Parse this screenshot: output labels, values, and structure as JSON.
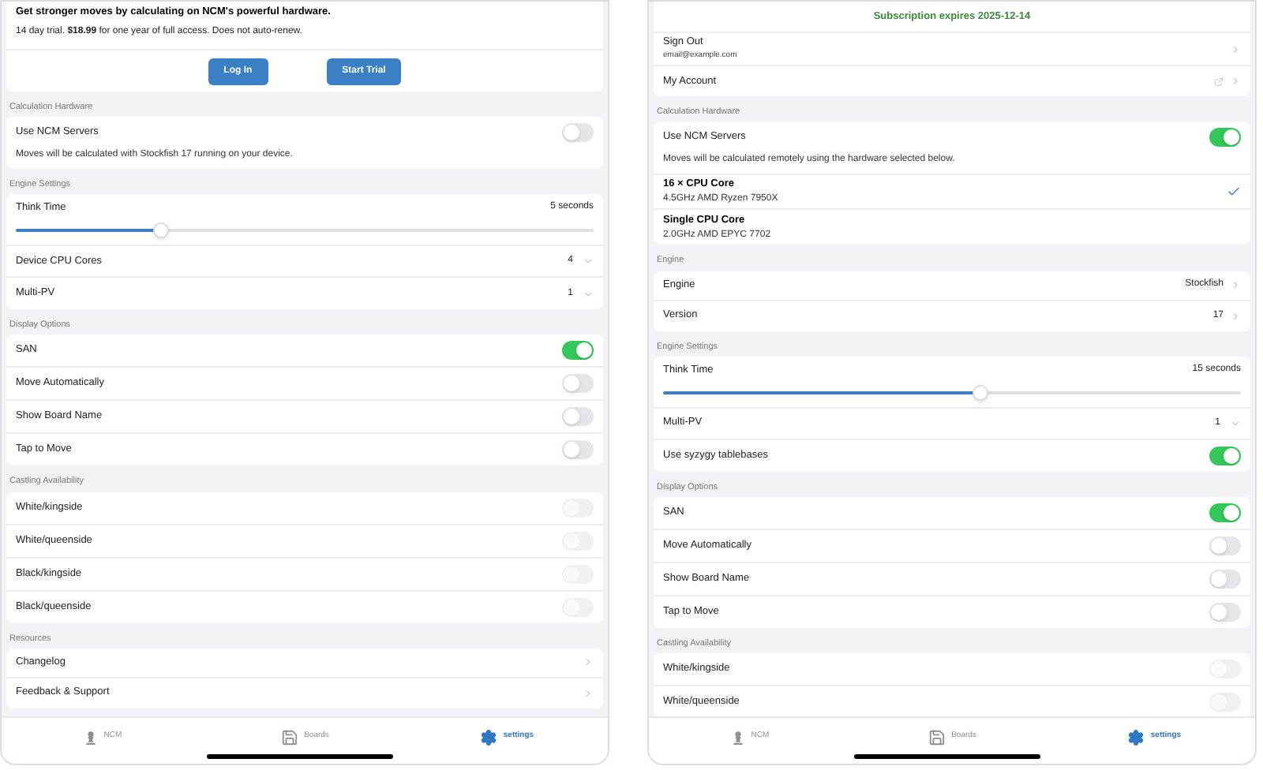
{
  "panels": [
    {
      "sections": [
        {
          "rows": [
            {
              "kind": "promo",
              "title": "Get stronger moves by calculating on NCM's powerful hardware.",
              "text": "14 day trial. **$18.99** for one year of full access. Does not auto-renew."
            },
            {
              "kind": "buttons",
              "buttons": [
                "Log In",
                "Start Trial"
              ]
            }
          ]
        },
        {
          "header": "Calculation Hardware",
          "rows": [
            {
              "kind": "toggle",
              "label": "Use NCM Servers",
              "on": false,
              "disabled": false,
              "note": "Moves will be calculated with Stockfish 17 running on your device."
            }
          ]
        },
        {
          "header": "Engine Settings",
          "rows": [
            {
              "kind": "slider",
              "label": "Think Time",
              "reading": "5 seconds",
              "level": 0.25
            },
            {
              "kind": "select",
              "label": "Device CPU Cores",
              "value": "4"
            },
            {
              "kind": "select",
              "label": "Multi-PV",
              "value": "1"
            }
          ]
        },
        {
          "header": "Display Options",
          "rows": [
            {
              "kind": "toggle",
              "label": "SAN",
              "on": true,
              "disabled": false
            },
            {
              "kind": "toggle",
              "label": "Move Automatically",
              "on": false,
              "disabled": false
            },
            {
              "kind": "toggle",
              "label": "Show Board Name",
              "on": false,
              "disabled": false
            },
            {
              "kind": "toggle",
              "label": "Tap to Move",
              "on": false,
              "disabled": false
            }
          ]
        },
        {
          "header": "Castling Availability",
          "rows": [
            {
              "kind": "toggle",
              "label": "White/kingside",
              "on": false,
              "disabled": true
            },
            {
              "kind": "toggle",
              "label": "White/queenside",
              "on": false,
              "disabled": true
            },
            {
              "kind": "toggle",
              "label": "Black/kingside",
              "on": false,
              "disabled": true
            },
            {
              "kind": "toggle",
              "label": "Black/queenside",
              "on": false,
              "disabled": true
            }
          ]
        },
        {
          "header": "Resources",
          "rows": [
            {
              "kind": "nav",
              "label": "Changelog"
            },
            {
              "kind": "nav",
              "label": "Feedback & Support"
            }
          ]
        }
      ],
      "tabs": [
        {
          "label": "NCM",
          "kind": "pawn",
          "selected": false
        },
        {
          "label": "Boards",
          "kind": "disk",
          "selected": false
        },
        {
          "label": "settings",
          "kind": "gear",
          "selected": true
        }
      ]
    },
    {
      "sections": [
        {
          "rows": [
            {
              "kind": "status",
              "text": "Subscription expires 2025-12-14"
            },
            {
              "kind": "account",
              "label": "Sign Out",
              "sublabel": "email@example.com"
            },
            {
              "kind": "external",
              "label": "My Account"
            }
          ]
        },
        {
          "header": "Calculation Hardware",
          "rows": [
            {
              "kind": "toggle",
              "label": "Use NCM Servers",
              "on": true,
              "disabled": false,
              "note": "Moves will be calculated remotely using the hardware selected below."
            },
            {
              "kind": "option",
              "label": "16 × CPU Core",
              "sublabel": "4.5GHz AMD Ryzen 7950X",
              "selected": true
            },
            {
              "kind": "option",
              "label": "Single CPU Core",
              "sublabel": "2.0GHz AMD EPYC 7702",
              "selected": false
            }
          ]
        },
        {
          "header": "Engine",
          "rows": [
            {
              "kind": "nav",
              "label": "Engine",
              "value": "Stockfish"
            },
            {
              "kind": "nav",
              "label": "Version",
              "value": "17"
            }
          ]
        },
        {
          "header": "Engine Settings",
          "rows": [
            {
              "kind": "slider",
              "label": "Think Time",
              "reading": "15 seconds",
              "level": 0.55
            },
            {
              "kind": "select",
              "label": "Multi-PV",
              "value": "1"
            },
            {
              "kind": "toggle",
              "label": "Use syzygy tablebases",
              "on": true,
              "disabled": false
            }
          ]
        },
        {
          "header": "Display Options",
          "rows": [
            {
              "kind": "toggle",
              "label": "SAN",
              "on": true,
              "disabled": false
            },
            {
              "kind": "toggle",
              "label": "Move Automatically",
              "on": false,
              "disabled": false
            },
            {
              "kind": "toggle",
              "label": "Show Board Name",
              "on": false,
              "disabled": false
            },
            {
              "kind": "toggle",
              "label": "Tap to Move",
              "on": false,
              "disabled": false
            }
          ]
        },
        {
          "header": "Castling Availability",
          "rows": [
            {
              "kind": "toggle",
              "label": "White/kingside",
              "on": false,
              "disabled": true
            },
            {
              "kind": "toggle",
              "label": "White/queenside",
              "on": false,
              "disabled": true
            }
          ]
        }
      ],
      "tabs": [
        {
          "label": "NCM",
          "kind": "pawn",
          "selected": false
        },
        {
          "label": "Boards",
          "kind": "disk",
          "selected": false
        },
        {
          "label": "settings",
          "kind": "gear",
          "selected": true
        }
      ]
    }
  ]
}
